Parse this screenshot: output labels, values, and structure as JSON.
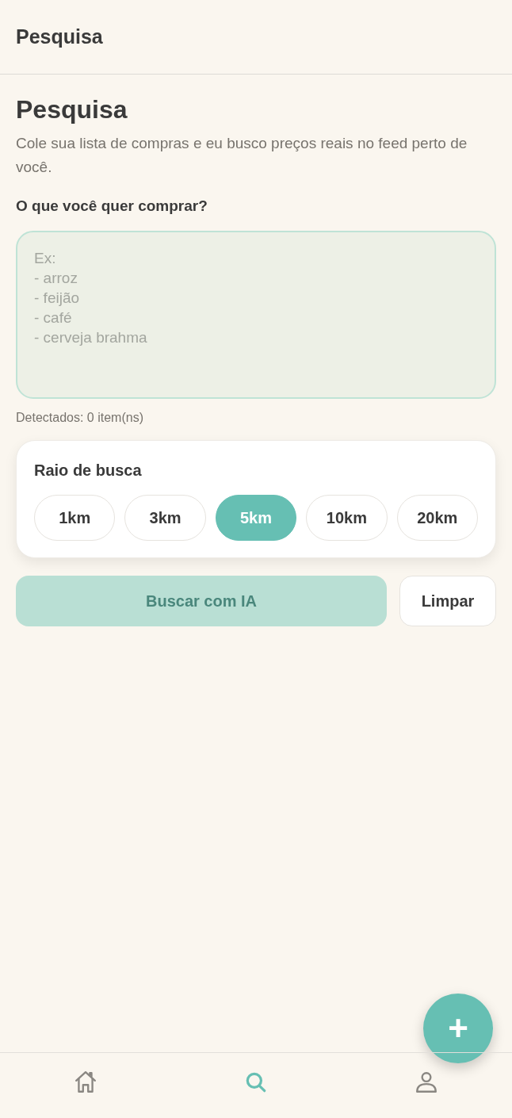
{
  "header": {
    "title": "Pesquisa"
  },
  "page": {
    "title": "Pesquisa",
    "subtitle": "Cole sua lista de compras e eu busco preços reais no feed perto de você."
  },
  "list_field": {
    "label": "O que você quer comprar?",
    "placeholder": "Ex:\n- arroz\n- feijão\n- café\n- cerveja brahma",
    "detected": "Detectados: 0 item(ns)"
  },
  "radius": {
    "title": "Raio de busca",
    "options": [
      {
        "label": "1km",
        "selected": false
      },
      {
        "label": "3km",
        "selected": false
      },
      {
        "label": "5km",
        "selected": true
      },
      {
        "label": "10km",
        "selected": false
      },
      {
        "label": "20km",
        "selected": false
      }
    ]
  },
  "actions": {
    "search": {
      "label": "Buscar com IA",
      "disabled": true
    },
    "clear": {
      "label": "Limpar"
    }
  },
  "fab": {
    "label": "+"
  },
  "bottom_nav": [
    {
      "kind": "home",
      "selected": false
    },
    {
      "kind": "search",
      "selected": true
    },
    {
      "kind": "profile",
      "selected": false
    }
  ]
}
